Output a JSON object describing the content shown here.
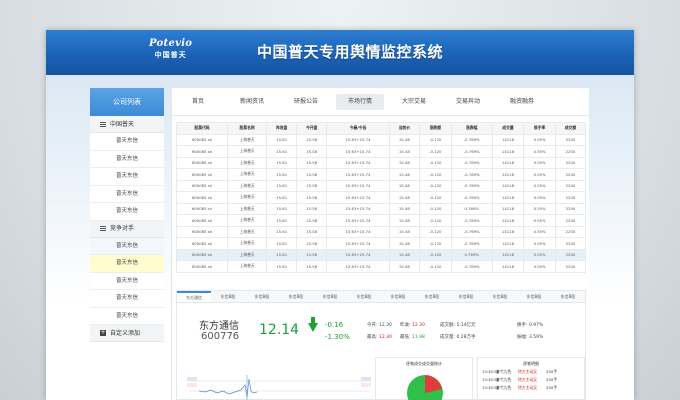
{
  "header": {
    "logo_en": "Potevio",
    "logo_cn": "中国普天",
    "title": "中国普天专用舆情监控系统"
  },
  "sidebar": {
    "title": "公司列表",
    "groups": [
      {
        "label": "中国普天",
        "items": [
          "普天东信",
          "普天东信",
          "普天东信",
          "普天东信",
          "普天东信"
        ]
      },
      {
        "label": "竞争对手",
        "items": [
          "普天东信",
          "普天东信",
          "普天东信",
          "普天东信",
          "普天东信"
        ]
      }
    ],
    "add_label": "自定义添加"
  },
  "tabs": [
    "首页",
    "新闻资讯",
    "研报公告",
    "市场行情",
    "大宗交易",
    "交易异动",
    "融资融券"
  ],
  "active_tab": 3,
  "table": {
    "headers": [
      "股票代码",
      "股票名称",
      "昨收盘",
      "今开盘",
      "今最/今低",
      "当前价",
      "涨跌额",
      "涨跌幅",
      "成交量",
      "换手率",
      "成交额"
    ],
    "rows": [
      [
        "600085 sh",
        "上海普天",
        "15.61",
        "15.58",
        "15.63+15.74",
        "15.48",
        "-0.120",
        "-0.769%",
        "14118",
        "0.55%",
        "2200"
      ],
      [
        "600085 sh",
        "上海普天",
        "15.61",
        "15.58",
        "15.63+15.74",
        "15.48",
        "-0.120",
        "-0.769%",
        "14118",
        "0.55%",
        "2200"
      ],
      [
        "600085 sh",
        "上海普天",
        "15.61",
        "15.58",
        "15.63+15.74",
        "15.48",
        "-0.120",
        "-0.769%",
        "14118",
        "0.55%",
        "2200"
      ],
      [
        "600085 sh",
        "上海普天",
        "15.61",
        "15.58",
        "15.63+15.74",
        "15.48",
        "-0.120",
        "-0.769%",
        "14118",
        "0.55%",
        "2200"
      ],
      [
        "600085 sh",
        "上海普天",
        "15.61",
        "15.58",
        "15.63+15.74",
        "15.48",
        "-0.120",
        "-0.769%",
        "14118",
        "0.55%",
        "2200"
      ],
      [
        "600085 sh",
        "上海普天",
        "15.61",
        "15.58",
        "15.63+15.74",
        "15.48",
        "-0.120",
        "-0.769%",
        "14118",
        "0.55%",
        "2200"
      ],
      [
        "600085 sh",
        "上海普天",
        "15.61",
        "15.58",
        "15.63+15.74",
        "15.48",
        "-0.120",
        "0.769%",
        "14118",
        "0.55%",
        "2200"
      ],
      [
        "600085 sh",
        "上海普天",
        "15.61",
        "15.58",
        "15.63+15.74",
        "15.48",
        "-0.120",
        "-0.769%",
        "14118",
        "0.55%",
        "2200"
      ],
      [
        "600085 sh",
        "上海普天",
        "15.61",
        "15.58",
        "15.63+15.74",
        "15.48",
        "-0.120",
        "-0.769%",
        "14118",
        "0.55%",
        "2200"
      ],
      [
        "600085 sh",
        "上海普天",
        "15.61",
        "15.58",
        "15.63+15.74",
        "15.48",
        "-0.120",
        "-0.769%",
        "14118",
        "0.55%",
        "2200"
      ],
      [
        "600085 sh",
        "上海普天",
        "15.61",
        "15.58",
        "15.63+15.74",
        "15.48",
        "-0.120",
        "0.769%",
        "14118",
        "0.55%",
        "2200"
      ],
      [
        "600085 sh",
        "上海普天",
        "15.61",
        "15.58",
        "15.63+15.74",
        "15.48",
        "-0.120",
        "-0.769%",
        "14118",
        "0.55%",
        "2200"
      ]
    ],
    "selected_row": 10
  },
  "detail": {
    "subtabs": [
      "东方通信",
      "东信B股",
      "东信B股",
      "东信B股",
      "东信B股",
      "东信B股",
      "东信B股",
      "东信B股",
      "东信B股",
      "东信B股",
      "东信B股",
      "东信B股"
    ],
    "stock_name": "东方通信",
    "stock_code": "600776",
    "price": "12.14",
    "change": "-0.16",
    "change_pct": "-1.30%",
    "open_label": "今开:",
    "open_value": "12.30",
    "prev_label": "昨收:",
    "prev_value": "12.30",
    "high_label": "最高:",
    "high_value": "12.30",
    "low_label": "最低:",
    "low_value": "11.98",
    "turnover_label": "成交额:",
    "turnover_value": "5.14亿元",
    "volume_label": "成交量:",
    "volume_value": "0.28万手",
    "rate_label": "换手:",
    "rate_value": "0.97%",
    "amp_label": "振幅:",
    "amp_value": "3.59%",
    "pie_title": "逐笔成交成交量统计",
    "deals_title": "逐笔明细",
    "deals": [
      [
        "13:35:58",
        "复弋九色",
        "特大主动买",
        "250手"
      ],
      [
        "13:35:58",
        "复弋九色",
        "特大主动买",
        "250手"
      ],
      [
        "13:35:58",
        "复弋九色",
        "特大主动买",
        "250手"
      ]
    ]
  }
}
